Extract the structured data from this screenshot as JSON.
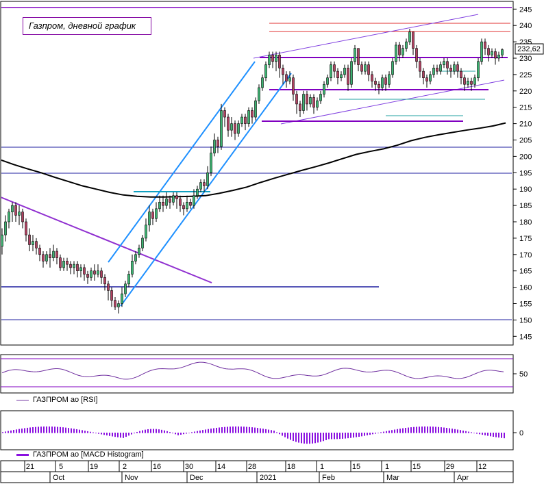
{
  "chart_data": {
    "type": "candlestick",
    "title": "Газпром, дневной график",
    "last_price": "232,62",
    "y_ticks": [
      145,
      150,
      155,
      160,
      165,
      170,
      175,
      180,
      185,
      190,
      195,
      200,
      205,
      210,
      215,
      220,
      225,
      230,
      235,
      240,
      245
    ],
    "ylim": [
      141,
      247
    ],
    "x_day_labels": [
      "21",
      "5",
      "19",
      "2",
      "16",
      "30",
      "14",
      "28",
      "18",
      "1",
      "15",
      "1",
      "15",
      "29",
      "12"
    ],
    "x_month_labels": [
      "Oct",
      "Nov",
      "Dec",
      "2021",
      "Feb",
      "Mar",
      "Apr"
    ],
    "moving_average": [
      [
        0,
        199
      ],
      [
        20,
        197.5
      ],
      [
        40,
        196.2
      ],
      [
        60,
        195
      ],
      [
        80,
        193.6
      ],
      [
        100,
        192.3
      ],
      [
        120,
        191
      ],
      [
        140,
        190
      ],
      [
        160,
        189
      ],
      [
        180,
        188.2
      ],
      [
        200,
        187.8
      ],
      [
        220,
        187.6
      ],
      [
        240,
        187.6
      ],
      [
        260,
        187.7
      ],
      [
        280,
        187.8
      ],
      [
        300,
        188
      ],
      [
        320,
        188.7
      ],
      [
        340,
        189.6
      ],
      [
        360,
        190.6
      ],
      [
        380,
        192
      ],
      [
        400,
        193.3
      ],
      [
        420,
        194.5
      ],
      [
        440,
        195.7
      ],
      [
        460,
        196.8
      ],
      [
        480,
        198
      ],
      [
        500,
        199.3
      ],
      [
        520,
        200.6
      ],
      [
        540,
        201.5
      ],
      [
        560,
        202.3
      ],
      [
        580,
        203.4
      ],
      [
        600,
        204.8
      ],
      [
        620,
        205.8
      ],
      [
        640,
        206.6
      ],
      [
        660,
        207.3
      ],
      [
        680,
        208
      ],
      [
        700,
        208.6
      ],
      [
        720,
        209.3
      ],
      [
        738,
        210.2
      ]
    ],
    "candles": [
      [
        3,
        172.5,
        176,
        170,
        178
      ],
      [
        8,
        176,
        180,
        174,
        182
      ],
      [
        13,
        180,
        183,
        178,
        184
      ],
      [
        18,
        183,
        185,
        180,
        186
      ],
      [
        23,
        185,
        182,
        180,
        186
      ],
      [
        28,
        182,
        183,
        179,
        185
      ],
      [
        33,
        183,
        180,
        178,
        184
      ],
      [
        38,
        180,
        176,
        174,
        181
      ],
      [
        43,
        176,
        173,
        171,
        178
      ],
      [
        48,
        173,
        174,
        171,
        176
      ],
      [
        53,
        174,
        172,
        170,
        175
      ],
      [
        58,
        172,
        170,
        168,
        173
      ],
      [
        63,
        170,
        168,
        166,
        171
      ],
      [
        68,
        168,
        170,
        167,
        171
      ],
      [
        73,
        170,
        169,
        166,
        172
      ],
      [
        78,
        169,
        171,
        168,
        173
      ],
      [
        83,
        171,
        169,
        167,
        172
      ],
      [
        88,
        169,
        166,
        165,
        170
      ],
      [
        93,
        166,
        168,
        165,
        169
      ],
      [
        98,
        168,
        167,
        165,
        169
      ],
      [
        103,
        167,
        166,
        164,
        168
      ],
      [
        108,
        166,
        167,
        164,
        168
      ],
      [
        113,
        167,
        165,
        163,
        168
      ],
      [
        118,
        165,
        166,
        163,
        167
      ],
      [
        123,
        166,
        164,
        162,
        167
      ],
      [
        128,
        164,
        163,
        161,
        165
      ],
      [
        133,
        163,
        165,
        162,
        166
      ],
      [
        138,
        165,
        164,
        162,
        167
      ],
      [
        143,
        164,
        165,
        163,
        167
      ],
      [
        148,
        165,
        163,
        161,
        166
      ],
      [
        153,
        163,
        161,
        159,
        164
      ],
      [
        158,
        161,
        159,
        156,
        162
      ],
      [
        163,
        159,
        156,
        154,
        160
      ],
      [
        168,
        156,
        154,
        153,
        157
      ],
      [
        173,
        154,
        155,
        152,
        156
      ],
      [
        178,
        155,
        158,
        154,
        160
      ],
      [
        183,
        158,
        161,
        157,
        162
      ],
      [
        188,
        161,
        164,
        160,
        165
      ],
      [
        193,
        164,
        168,
        163,
        170
      ],
      [
        198,
        168,
        170,
        167,
        171
      ],
      [
        203,
        170,
        172,
        169,
        173
      ],
      [
        208,
        172,
        175,
        171,
        176
      ],
      [
        213,
        175,
        179,
        174,
        181
      ],
      [
        218,
        179,
        183,
        177,
        185
      ],
      [
        223,
        183,
        181,
        179,
        184
      ],
      [
        228,
        181,
        184,
        180,
        186
      ],
      [
        233,
        184,
        186,
        183,
        188
      ],
      [
        238,
        186,
        185,
        183,
        188
      ],
      [
        243,
        185,
        187,
        184,
        189
      ],
      [
        248,
        187,
        186,
        184,
        188
      ],
      [
        253,
        186,
        188,
        185,
        189
      ],
      [
        258,
        188,
        187,
        184,
        189
      ],
      [
        263,
        187,
        185,
        183,
        188
      ],
      [
        268,
        185,
        184,
        182,
        186
      ],
      [
        273,
        184,
        186,
        183,
        188
      ],
      [
        278,
        186,
        185,
        184,
        187
      ],
      [
        283,
        185,
        188,
        184,
        190
      ],
      [
        288,
        188,
        190,
        187,
        191
      ],
      [
        293,
        190,
        192,
        189,
        193
      ],
      [
        298,
        192,
        191,
        189,
        193
      ],
      [
        303,
        191,
        195,
        190,
        197
      ],
      [
        308,
        195,
        201,
        194,
        203
      ],
      [
        313,
        201,
        205,
        200,
        207
      ],
      [
        318,
        205,
        203,
        201,
        206
      ],
      [
        323,
        203,
        214,
        202,
        216
      ],
      [
        328,
        214,
        212,
        209,
        215
      ],
      [
        333,
        212,
        208,
        206,
        213
      ],
      [
        338,
        208,
        210,
        206,
        212
      ],
      [
        343,
        210,
        207,
        205,
        211
      ],
      [
        348,
        207,
        210,
        206,
        211
      ],
      [
        353,
        210,
        212,
        209,
        213
      ],
      [
        358,
        212,
        210,
        208,
        213
      ],
      [
        363,
        210,
        214,
        209,
        215
      ],
      [
        368,
        214,
        212,
        210,
        215
      ],
      [
        373,
        212,
        217,
        211,
        218
      ],
      [
        378,
        217,
        221,
        216,
        222
      ],
      [
        383,
        221,
        224,
        220,
        225
      ],
      [
        388,
        224,
        228,
        223,
        229
      ],
      [
        393,
        228,
        231,
        227,
        232
      ],
      [
        398,
        231,
        229,
        227,
        232
      ],
      [
        403,
        229,
        231,
        226,
        232
      ],
      [
        408,
        231,
        227,
        224,
        232
      ],
      [
        413,
        227,
        225,
        222,
        228
      ],
      [
        418,
        225,
        223,
        221,
        226
      ],
      [
        423,
        223,
        224,
        222,
        226
      ],
      [
        428,
        224,
        219,
        217,
        225
      ],
      [
        433,
        219,
        216,
        213,
        220
      ],
      [
        438,
        216,
        214,
        212,
        217
      ],
      [
        443,
        214,
        219,
        213,
        220
      ],
      [
        448,
        219,
        216,
        214,
        220
      ],
      [
        453,
        216,
        218,
        215,
        219
      ],
      [
        458,
        218,
        215,
        213,
        219
      ],
      [
        463,
        215,
        217,
        214,
        218
      ],
      [
        468,
        217,
        219,
        216,
        220
      ],
      [
        473,
        219,
        222,
        218,
        223
      ],
      [
        478,
        222,
        224,
        221,
        225
      ],
      [
        483,
        224,
        228,
        223,
        229
      ],
      [
        488,
        228,
        226,
        224,
        229
      ],
      [
        493,
        226,
        224,
        222,
        227
      ],
      [
        498,
        224,
        225,
        223,
        226
      ],
      [
        503,
        225,
        227,
        224,
        228
      ],
      [
        508,
        227,
        222,
        220,
        228
      ],
      [
        513,
        222,
        229,
        221,
        230
      ],
      [
        518,
        229,
        233,
        228,
        234
      ],
      [
        523,
        233,
        228,
        226,
        233
      ],
      [
        528,
        228,
        226,
        225,
        229
      ],
      [
        533,
        226,
        228,
        225,
        229
      ],
      [
        538,
        228,
        225,
        223,
        229
      ],
      [
        543,
        225,
        223,
        221,
        226
      ],
      [
        548,
        223,
        222,
        220,
        224
      ],
      [
        553,
        222,
        221,
        219,
        223
      ],
      [
        558,
        221,
        224,
        220,
        225
      ],
      [
        563,
        224,
        222,
        220,
        225
      ],
      [
        568,
        222,
        225,
        221,
        226
      ],
      [
        573,
        225,
        229,
        224,
        230
      ],
      [
        578,
        229,
        234,
        228,
        235
      ],
      [
        583,
        234,
        231,
        229,
        235
      ],
      [
        588,
        231,
        233,
        230,
        234
      ],
      [
        593,
        233,
        235,
        232,
        236
      ],
      [
        598,
        235,
        238,
        234,
        239
      ],
      [
        603,
        238,
        233,
        231,
        238
      ],
      [
        608,
        233,
        229,
        227,
        234
      ],
      [
        613,
        229,
        226,
        224,
        230
      ],
      [
        618,
        226,
        224,
        222,
        227
      ],
      [
        623,
        224,
        223,
        221,
        225
      ],
      [
        628,
        223,
        225,
        222,
        226
      ],
      [
        633,
        225,
        227,
        224,
        228
      ],
      [
        638,
        227,
        226,
        225,
        228
      ],
      [
        643,
        226,
        228,
        225,
        229
      ],
      [
        648,
        228,
        229,
        227,
        230
      ],
      [
        653,
        229,
        227,
        225,
        230
      ],
      [
        658,
        227,
        226,
        224,
        228
      ],
      [
        663,
        226,
        228,
        225,
        229
      ],
      [
        668,
        228,
        226,
        224,
        229
      ],
      [
        673,
        226,
        224,
        222,
        227
      ],
      [
        678,
        224,
        222,
        220,
        225
      ],
      [
        683,
        222,
        223,
        221,
        224
      ],
      [
        688,
        223,
        222,
        220,
        224
      ],
      [
        693,
        222,
        224,
        221,
        225
      ],
      [
        698,
        224,
        229,
        223,
        230
      ],
      [
        703,
        229,
        235,
        228,
        236
      ],
      [
        708,
        235,
        233,
        231,
        236
      ],
      [
        713,
        233,
        231,
        229,
        234
      ],
      [
        718,
        231,
        232,
        230,
        233
      ],
      [
        723,
        232,
        230,
        228,
        233
      ],
      [
        728,
        230,
        231,
        229,
        232
      ],
      [
        733,
        231,
        232.6,
        230,
        233
      ]
    ],
    "indicators": [
      {
        "name": "ГАЗПРОМ ао [RSI]",
        "level_label": "50"
      },
      {
        "name": "ГАЗПРОМ ао [MACD Histogram]",
        "level_label": "0"
      }
    ]
  }
}
